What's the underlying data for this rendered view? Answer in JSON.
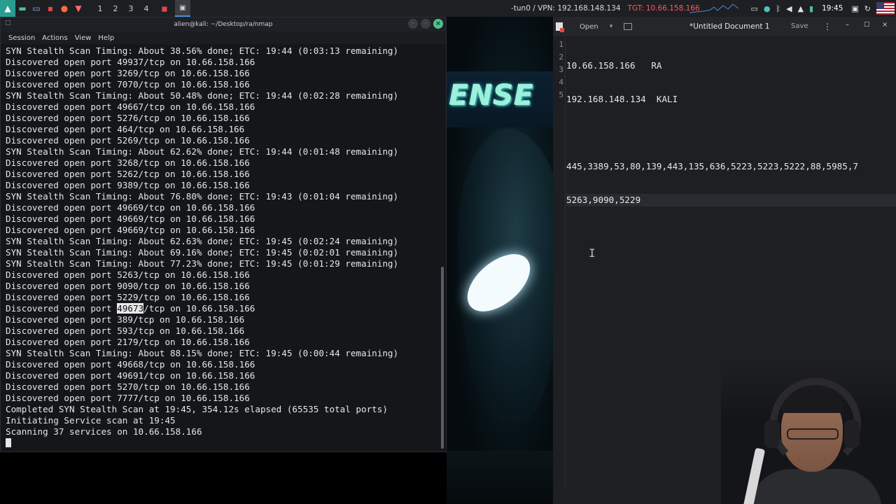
{
  "topbar": {
    "workspaces": [
      "1",
      "2",
      "3",
      "4"
    ],
    "vpn_text": "-tun0 / VPN: 192.168.148.134",
    "target_text": "TGT: 10.66.158.166",
    "clock": "19:45",
    "colors": {
      "target": "#ff5a5a",
      "kali_icon": "#2a9d8f"
    },
    "icons": [
      "kali-menu-icon",
      "terminal-app-icon",
      "file-manager-icon",
      "text-editor-icon",
      "firefox-icon",
      "burp-icon",
      "shell-icon",
      "video-icon",
      "terminal-task-icon",
      "monitor-icon",
      "update-icon",
      "bluetooth-icon",
      "volume-icon",
      "notifications-icon",
      "battery-icon",
      "lock-icon",
      "refresh-icon",
      "us-flag-icon"
    ]
  },
  "terminal": {
    "title": "alien@kali: ~/Desktop/ra/nmap",
    "menu": [
      "Session",
      "Actions",
      "View",
      "Help"
    ],
    "highlighted_port": "49673",
    "lines": [
      "SYN Stealth Scan Timing: About 38.56% done; ETC: 19:44 (0:03:13 remaining)",
      "Discovered open port 49937/tcp on 10.66.158.166",
      "Discovered open port 3269/tcp on 10.66.158.166",
      "Discovered open port 7070/tcp on 10.66.158.166",
      "SYN Stealth Scan Timing: About 50.48% done; ETC: 19:44 (0:02:28 remaining)",
      "Discovered open port 49667/tcp on 10.66.158.166",
      "Discovered open port 5276/tcp on 10.66.158.166",
      "Discovered open port 464/tcp on 10.66.158.166",
      "Discovered open port 5269/tcp on 10.66.158.166",
      "SYN Stealth Scan Timing: About 62.62% done; ETC: 19:44 (0:01:48 remaining)",
      "Discovered open port 3268/tcp on 10.66.158.166",
      "Discovered open port 5262/tcp on 10.66.158.166",
      "Discovered open port 9389/tcp on 10.66.158.166",
      "SYN Stealth Scan Timing: About 76.80% done; ETC: 19:43 (0:01:04 remaining)",
      "Discovered open port 49669/tcp on 10.66.158.166",
      "Discovered open port 49669/tcp on 10.66.158.166",
      "Discovered open port 49669/tcp on 10.66.158.166",
      "SYN Stealth Scan Timing: About 62.63% done; ETC: 19:45 (0:02:24 remaining)",
      "SYN Stealth Scan Timing: About 69.16% done; ETC: 19:45 (0:02:01 remaining)",
      "SYN Stealth Scan Timing: About 77.23% done; ETC: 19:45 (0:01:29 remaining)",
      "Discovered open port 5263/tcp on 10.66.158.166",
      "Discovered open port 9090/tcp on 10.66.158.166",
      "Discovered open port 5229/tcp on 10.66.158.166",
      "Discovered open port 49673/tcp on 10.66.158.166",
      "Discovered open port 389/tcp on 10.66.158.166",
      "Discovered open port 593/tcp on 10.66.158.166",
      "Discovered open port 2179/tcp on 10.66.158.166",
      "SYN Stealth Scan Timing: About 88.15% done; ETC: 19:45 (0:00:44 remaining)",
      "Discovered open port 49668/tcp on 10.66.158.166",
      "Discovered open port 49691/tcp on 10.66.158.166",
      "Discovered open port 5270/tcp on 10.66.158.166",
      "Discovered open port 7777/tcp on 10.66.158.166",
      "Completed SYN Stealth Scan at 19:45, 354.12s elapsed (65535 total ports)",
      "Initiating Service scan at 19:45",
      "Scanning 37 services on 10.66.158.166"
    ]
  },
  "wallpaper": {
    "logo_text": "ENSE"
  },
  "editor": {
    "open_label": "Open",
    "save_label": "Save",
    "title": "*Untitled Document 1",
    "line_numbers": [
      "1",
      "2",
      "3",
      "4",
      "5"
    ],
    "lines": [
      "10.66.158.166   RA",
      "192.168.148.134  KALI",
      "",
      "445,3389,53,80,139,443,135,636,5223,5223,5222,88,5985,7",
      "5263,9090,5229"
    ]
  }
}
